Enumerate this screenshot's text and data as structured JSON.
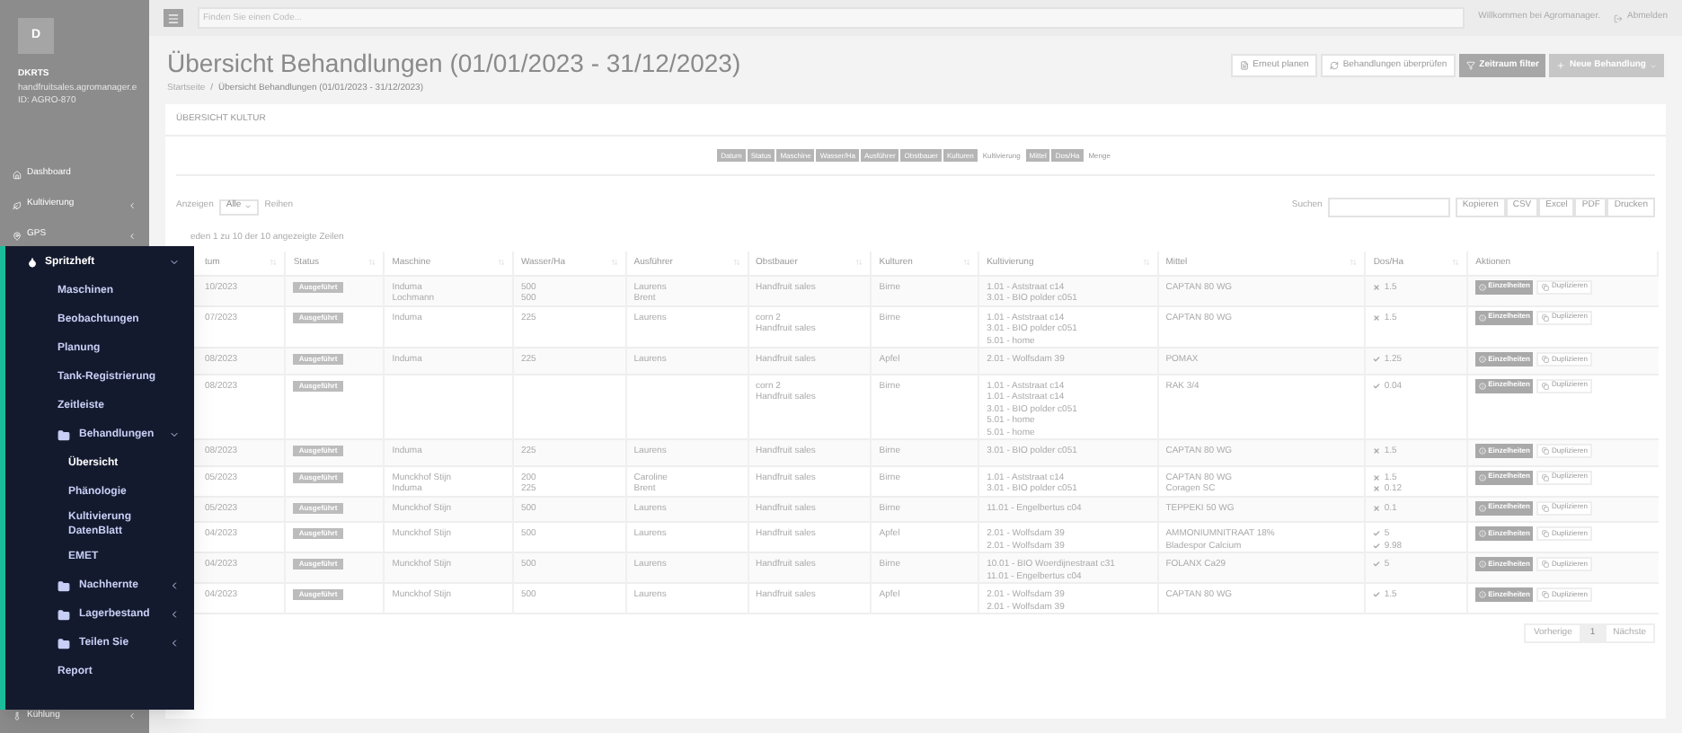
{
  "header": {
    "search_placeholder": "Finden Sie einen Code...",
    "welcome": "Willkommen bei Agromanager.",
    "logout": "Abmelden"
  },
  "sidebar": {
    "avatar": "D",
    "user": "DKRTS",
    "email": "handfruitsales.agromanager.e",
    "id": "ID: AGRO-870",
    "items": [
      {
        "label": "Dashboard",
        "kind": "link"
      },
      {
        "label": "Kultivierung",
        "kind": "folder",
        "expanded": false
      },
      {
        "label": "GPS",
        "kind": "folder",
        "expanded": false
      }
    ],
    "bottom_items": [
      {
        "label": "Kühlung",
        "kind": "folder",
        "expanded": false
      }
    ]
  },
  "menu": {
    "label": "Spritzheft",
    "expanded": true,
    "children": [
      {
        "label": "Maschinen",
        "kind": "link",
        "selected": false
      },
      {
        "label": "Beobachtungen",
        "kind": "link",
        "selected": false
      },
      {
        "label": "Planung",
        "kind": "link",
        "selected": false
      },
      {
        "label": "Tank-Registrierung",
        "kind": "link",
        "selected": false
      },
      {
        "label": "Zeitleiste",
        "kind": "link",
        "selected": false
      },
      {
        "label": "Behandlungen",
        "kind": "folder",
        "expanded": true,
        "children": [
          {
            "label": "Übersicht",
            "kind": "link",
            "selected": true
          },
          {
            "label": "Phänologie",
            "kind": "link",
            "selected": false
          },
          {
            "label": "Kultivierung DatenBlatt",
            "kind": "link",
            "selected": false
          },
          {
            "label": "EMET",
            "kind": "link",
            "selected": false
          }
        ]
      },
      {
        "label": "Nachhernte",
        "kind": "folder",
        "expanded": false
      },
      {
        "label": "Lagerbestand",
        "kind": "folder",
        "expanded": false
      },
      {
        "label": "Teilen Sie",
        "kind": "folder",
        "expanded": false
      },
      {
        "label": "Report",
        "kind": "link",
        "selected": false
      }
    ]
  },
  "page": {
    "title": "Übersicht Behandlungen (01/01/2023 - 31/12/2023)",
    "breadcrumb_separator": "/",
    "breadcrumb": [
      "Startseite",
      "Übersicht Behandlungen (01/01/2023 - 31/12/2023)"
    ],
    "buttons": [
      {
        "label": "Erneut planen",
        "kind": "plain"
      },
      {
        "label": "Behandlungen überprüfen",
        "kind": "plain"
      },
      {
        "label": "Zeitraum filter",
        "kind": "dark"
      },
      {
        "label": "Neue Behandlung",
        "kind": "menu"
      }
    ]
  },
  "card": {
    "title": "ÜBERSICHT KULTUR",
    "column_toggles": [
      {
        "label": "Datum",
        "selected": true
      },
      {
        "label": "Status",
        "selected": true
      },
      {
        "label": "Maschine",
        "selected": true
      },
      {
        "label": "Wasser/Ha",
        "selected": true
      },
      {
        "label": "Ausführer",
        "selected": true
      },
      {
        "label": "Obstbauer",
        "selected": true
      },
      {
        "label": "Kulturen",
        "selected": true
      },
      {
        "label": "Kultivierung",
        "selected": false
      },
      {
        "label": "Mittel",
        "selected": true
      },
      {
        "label": "Dos/Ha",
        "selected": true
      },
      {
        "label": "Menge",
        "selected": false
      }
    ],
    "length": {
      "before": "Anzeigen",
      "value": "Alle",
      "after": "Reihen"
    },
    "search_label": "Suchen",
    "export_buttons": [
      "Kopieren",
      "CSV",
      "Excel",
      "PDF",
      "Drucken"
    ],
    "info": "eden 1 zu 10 der 10 angezeigte Zeilen",
    "columns": [
      "tum",
      "Status",
      "Maschine",
      "Wasser/Ha",
      "Ausführer",
      "Obstbauer",
      "Kulturen",
      "Kultivierung",
      "Mittel",
      "Dos/Ha",
      "Aktionen"
    ],
    "rows": [
      {
        "date": "10/2023",
        "status": "Ausgeführt",
        "machine": [
          "Induma",
          "Lochmann"
        ],
        "water": [
          "500",
          "500"
        ],
        "executor": [
          "Laurens",
          "Brent"
        ],
        "grower": [
          "Handfruit sales"
        ],
        "crop": "Birne",
        "cultivation": [
          "1.01 - Aststraat c14",
          "3.01 - BIO polder c051"
        ],
        "product": [
          "CAPTAN 80 WG"
        ],
        "dose": [
          {
            "kind": "cross",
            "value": "1.5"
          }
        ],
        "actions": [
          "Einzelheiten",
          "Duplizieren"
        ]
      },
      {
        "date": "07/2023",
        "status": "Ausgeführt",
        "machine": [
          "Induma"
        ],
        "water": [
          "225"
        ],
        "executor": [
          "Laurens"
        ],
        "grower": [
          "corn 2",
          "Handfruit sales"
        ],
        "crop": "Birne",
        "cultivation": [
          "1.01 - Aststraat c14",
          "3.01 - BIO polder c051",
          "5.01 - home"
        ],
        "product": [
          "CAPTAN 80 WG"
        ],
        "dose": [
          {
            "kind": "cross",
            "value": "1.5"
          }
        ],
        "actions": [
          "Einzelheiten",
          "Duplizieren"
        ]
      },
      {
        "date": "08/2023",
        "status": "Ausgeführt",
        "machine": [
          "Induma"
        ],
        "water": [
          "225"
        ],
        "executor": [
          "Laurens"
        ],
        "grower": [
          "Handfruit sales"
        ],
        "crop": "Apfel",
        "cultivation": [
          "2.01 - Wolfsdam 39"
        ],
        "product": [
          "POMAX"
        ],
        "dose": [
          {
            "kind": "check",
            "value": "1.25"
          }
        ],
        "actions": [
          "Einzelheiten",
          "Duplizieren"
        ]
      },
      {
        "date": "08/2023",
        "status": "Ausgeführt",
        "machine": [],
        "water": [],
        "executor": [],
        "grower": [
          "corn 2",
          "Handfruit sales"
        ],
        "crop": "Birne",
        "cultivation": [
          "1.01 - Aststraat c14",
          "1.01 - Aststraat c14",
          "3.01 - BIO polder c051",
          "5.01 - home",
          "5.01 - home"
        ],
        "product": [
          "RAK 3/4"
        ],
        "dose": [
          {
            "kind": "check",
            "value": "0.04"
          }
        ],
        "actions": [
          "Einzelheiten",
          "Duplizieren"
        ]
      },
      {
        "date": "08/2023",
        "status": "Ausgeführt",
        "machine": [
          "Induma"
        ],
        "water": [
          "225"
        ],
        "executor": [
          "Laurens"
        ],
        "grower": [
          "Handfruit sales"
        ],
        "crop": "Birne",
        "cultivation": [
          "3.01 - BIO polder c051"
        ],
        "product": [
          "CAPTAN 80 WG"
        ],
        "dose": [
          {
            "kind": "cross",
            "value": "1.5"
          }
        ],
        "actions": [
          "Einzelheiten",
          "Duplizieren"
        ]
      },
      {
        "date": "05/2023",
        "status": "Ausgeführt",
        "machine": [
          "Munckhof Stijn",
          "Induma"
        ],
        "water": [
          "200",
          "225"
        ],
        "executor": [
          "Caroline",
          "Brent"
        ],
        "grower": [
          "Handfruit sales"
        ],
        "crop": "Birne",
        "cultivation": [
          "1.01 - Aststraat c14",
          "3.01 - BIO polder c051"
        ],
        "product": [
          "CAPTAN 80 WG",
          "Coragen SC"
        ],
        "dose": [
          {
            "kind": "cross",
            "value": "1.5"
          },
          {
            "kind": "cross",
            "value": "0.12"
          }
        ],
        "actions": [
          "Einzelheiten",
          "Duplizieren"
        ]
      },
      {
        "date": "05/2023",
        "status": "Ausgeführt",
        "machine": [
          "Munckhof Stijn"
        ],
        "water": [
          "500"
        ],
        "executor": [
          "Laurens"
        ],
        "grower": [
          "Handfruit sales"
        ],
        "crop": "Birne",
        "cultivation": [
          "11.01 - Engelbertus c04"
        ],
        "product": [
          "TEPPEKI 50 WG"
        ],
        "dose": [
          {
            "kind": "cross",
            "value": "0.1"
          }
        ],
        "actions": [
          "Einzelheiten",
          "Duplizieren"
        ]
      },
      {
        "date": "04/2023",
        "status": "Ausgeführt",
        "machine": [
          "Munckhof Stijn"
        ],
        "water": [
          "500"
        ],
        "executor": [
          "Laurens"
        ],
        "grower": [
          "Handfruit sales"
        ],
        "crop": "Apfel",
        "cultivation": [
          "2.01 - Wolfsdam 39",
          "2.01 - Wolfsdam 39"
        ],
        "product": [
          "AMMONIUMNITRAAT 18%",
          "Bladespor Calcium"
        ],
        "dose": [
          {
            "kind": "check",
            "value": "5"
          },
          {
            "kind": "check",
            "value": "9.98"
          }
        ],
        "actions": [
          "Einzelheiten",
          "Duplizieren"
        ]
      },
      {
        "date": "04/2023",
        "status": "Ausgeführt",
        "machine": [
          "Munckhof Stijn"
        ],
        "water": [
          "500"
        ],
        "executor": [
          "Laurens"
        ],
        "grower": [
          "Handfruit sales"
        ],
        "crop": "Birne",
        "cultivation": [
          "10.01 - BIO Woerdijnestraat c31",
          "11.01 - Engelbertus c04"
        ],
        "product": [
          "FOLANX Ca29"
        ],
        "dose": [
          {
            "kind": "check",
            "value": "5"
          }
        ],
        "actions": [
          "Einzelheiten",
          "Duplizieren"
        ]
      },
      {
        "date": "04/2023",
        "status": "Ausgeführt",
        "machine": [
          "Munckhof Stijn"
        ],
        "water": [
          "500"
        ],
        "executor": [
          "Laurens"
        ],
        "grower": [
          "Handfruit sales"
        ],
        "crop": "Apfel",
        "cultivation": [
          "2.01 - Wolfsdam 39",
          "2.01 - Wolfsdam 39"
        ],
        "product": [
          "CAPTAN 80 WG"
        ],
        "dose": [
          {
            "kind": "check",
            "value": "1.5"
          }
        ],
        "actions": [
          "Einzelheiten",
          "Duplizieren"
        ]
      }
    ],
    "pagination": [
      {
        "label": "Vorherige",
        "selected": false
      },
      {
        "label": "1",
        "selected": true
      },
      {
        "label": "Nächste",
        "selected": false
      }
    ]
  }
}
